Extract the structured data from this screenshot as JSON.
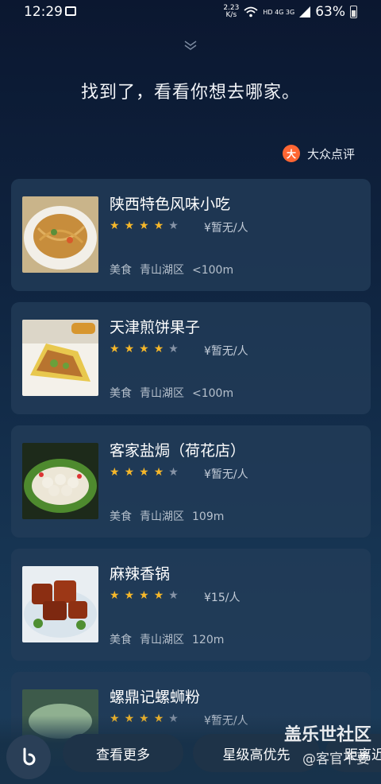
{
  "status_bar": {
    "time": "12:29",
    "speed_value": "2.23",
    "speed_unit": "K/s",
    "network": "HD 4G 3G",
    "battery": "63%"
  },
  "prompt": "找到了，看看你想去哪家。",
  "source": {
    "logo_text": "大",
    "label": "大众点评"
  },
  "restaurants": [
    {
      "name": "陕西特色风味小吃",
      "rating": 4,
      "price": "¥暂无/人",
      "category": "美食",
      "district": "青山湖区",
      "distance": "<100m"
    },
    {
      "name": "天津煎饼果子",
      "rating": 4,
      "price": "¥暂无/人",
      "category": "美食",
      "district": "青山湖区",
      "distance": "<100m"
    },
    {
      "name": "客家盐焗（荷花店）",
      "rating": 4,
      "price": "¥暂无/人",
      "category": "美食",
      "district": "青山湖区",
      "distance": "109m"
    },
    {
      "name": "麻辣香锅",
      "rating": 4,
      "price": "¥15/人",
      "category": "美食",
      "district": "青山湖区",
      "distance": "120m"
    },
    {
      "name": "螺鼎记螺蛳粉",
      "rating": 4,
      "price": "¥暂无/人",
      "category": "美食",
      "district": "青山湖区",
      "distance": ""
    }
  ],
  "bottom_bar": {
    "more_label": "查看更多",
    "rating_first_label": "星级高优先",
    "distance_first_label": "距离近"
  },
  "watermark": {
    "title": "盖乐世社区",
    "author": "@客官不要"
  },
  "colors": {
    "star_active": "#f5b72a",
    "star_inactive": "#8693a6",
    "brand": "#ff6633"
  }
}
